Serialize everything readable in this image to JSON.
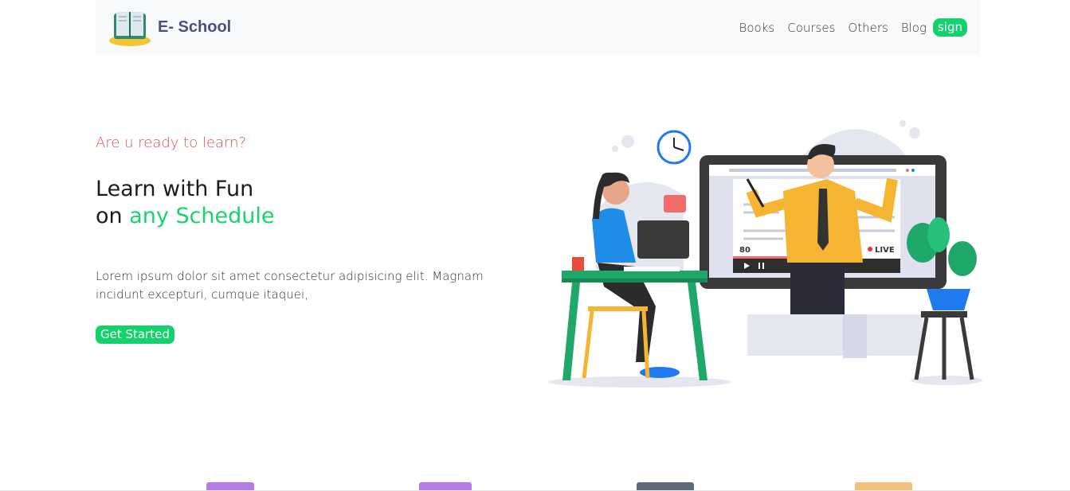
{
  "brand": {
    "name": "E- School",
    "logo_icon": "book-logo-icon"
  },
  "nav": {
    "links": [
      "Books",
      "Courses",
      "Others",
      "Blog"
    ],
    "sign_label": "sign"
  },
  "hero": {
    "tagline": "Are u ready to learn?",
    "title_line1": "Learn with Fun",
    "title_line2_prefix": "on ",
    "title_line2_accent": "any Schedule",
    "body": "Lorem ipsum dolor sit amet consectetur adipisicing elit. Magnam incidunt excepturi, cumque itaquei,",
    "cta_label": "Get Started"
  },
  "illustration": {
    "viewer_count": "80",
    "live_label": "LIVE",
    "icon": "online-learning-illustration"
  },
  "categories": [
    {
      "icon": "book-category-icon",
      "color": "#b57ce6"
    },
    {
      "icon": "tablet-category-icon",
      "color": "#b57ce6"
    },
    {
      "icon": "books-stack-icon",
      "color": "#5f6b7a"
    },
    {
      "icon": "art-supplies-icon",
      "color": "#f2c27a"
    }
  ],
  "colors": {
    "accent": "#12d26b",
    "tagline": "#d9534f",
    "brand": "#4b4e7e",
    "navbar_bg": "#f8f9fa"
  }
}
